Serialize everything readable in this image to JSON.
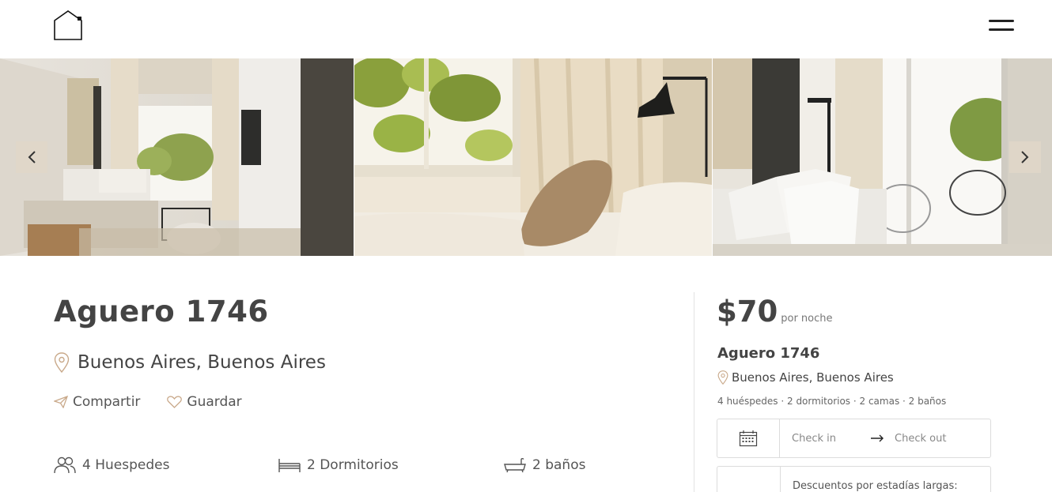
{
  "header": {
    "logo_icon": "house-outline-icon",
    "menu_icon": "hamburger-menu-icon"
  },
  "gallery": {
    "prev_icon": "chevron-left-icon",
    "next_icon": "chevron-right-icon"
  },
  "listing": {
    "title": "Aguero 1746",
    "location": "Buenos Aires, Buenos Aires",
    "share_label": "Compartir",
    "save_label": "Guardar",
    "guests": "4 Huespedes",
    "bedrooms": "2 Dormitorios",
    "bathrooms": "2 baños"
  },
  "booking": {
    "price": "$70",
    "per_night": "por noche",
    "title": "Aguero 1746",
    "location": "Buenos Aires, Buenos Aires",
    "specs": "4 huéspedes · 2 dormitorios · 2 camas · 2 baños",
    "check_in": "Check in",
    "check_out": "Check out",
    "discount_label": "Descuentos por estadías largas:"
  },
  "colors": {
    "text": "#444444",
    "accent_icon": "#c9a98a",
    "border": "#dcdcdc"
  }
}
